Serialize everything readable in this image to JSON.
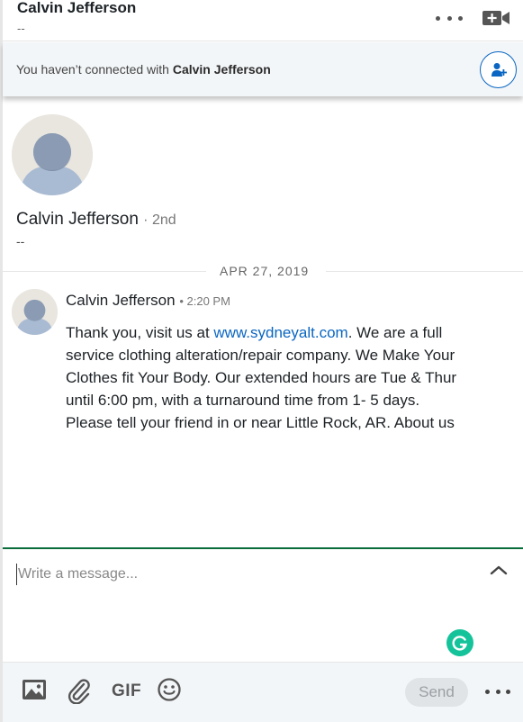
{
  "header": {
    "name": "Calvin Jefferson",
    "subtitle": "--",
    "more_icon": "more-horizontal-icon",
    "video_icon": "video-call-icon"
  },
  "banner": {
    "text_prefix": "You haven’t connected with",
    "name": "Calvin Jefferson",
    "connect_icon": "add-person-icon"
  },
  "profile": {
    "name": "Calvin Jefferson",
    "degree": "· 2nd",
    "subtitle": "--"
  },
  "conversation": {
    "date": "APR 27, 2019",
    "messages": [
      {
        "sender": "Calvin Jefferson",
        "time": "• 2:20 PM",
        "text_before_link": "Thank you, visit us at ",
        "link": "www.sydneyalt.com",
        "text_after_link": ". We are a full service clothing alteration/repair company. We Make Your Clothes fit Your Body. Our extended hours are Tue & Thur until 6:00 pm, with a turnaround time from 1- 5 days. Please tell your friend in or near Little Rock, AR. About us"
      }
    ]
  },
  "composer": {
    "placeholder": "Write a message...",
    "expand_icon": "chevron-up-icon",
    "grammarly_icon": "grammarly-icon"
  },
  "toolbar": {
    "image_icon": "image-icon",
    "attach_icon": "paperclip-icon",
    "gif_label": "GIF",
    "emoji_icon": "emoji-icon",
    "send_label": "Send",
    "more_icon": "more-horizontal-icon"
  },
  "colors": {
    "accent": "#0a66c2",
    "composer_border": "#0a6b3b",
    "grammarly": "#15c39a",
    "avatar_bg": "#e9e5df",
    "avatar_figure": "#8a9bb3"
  }
}
